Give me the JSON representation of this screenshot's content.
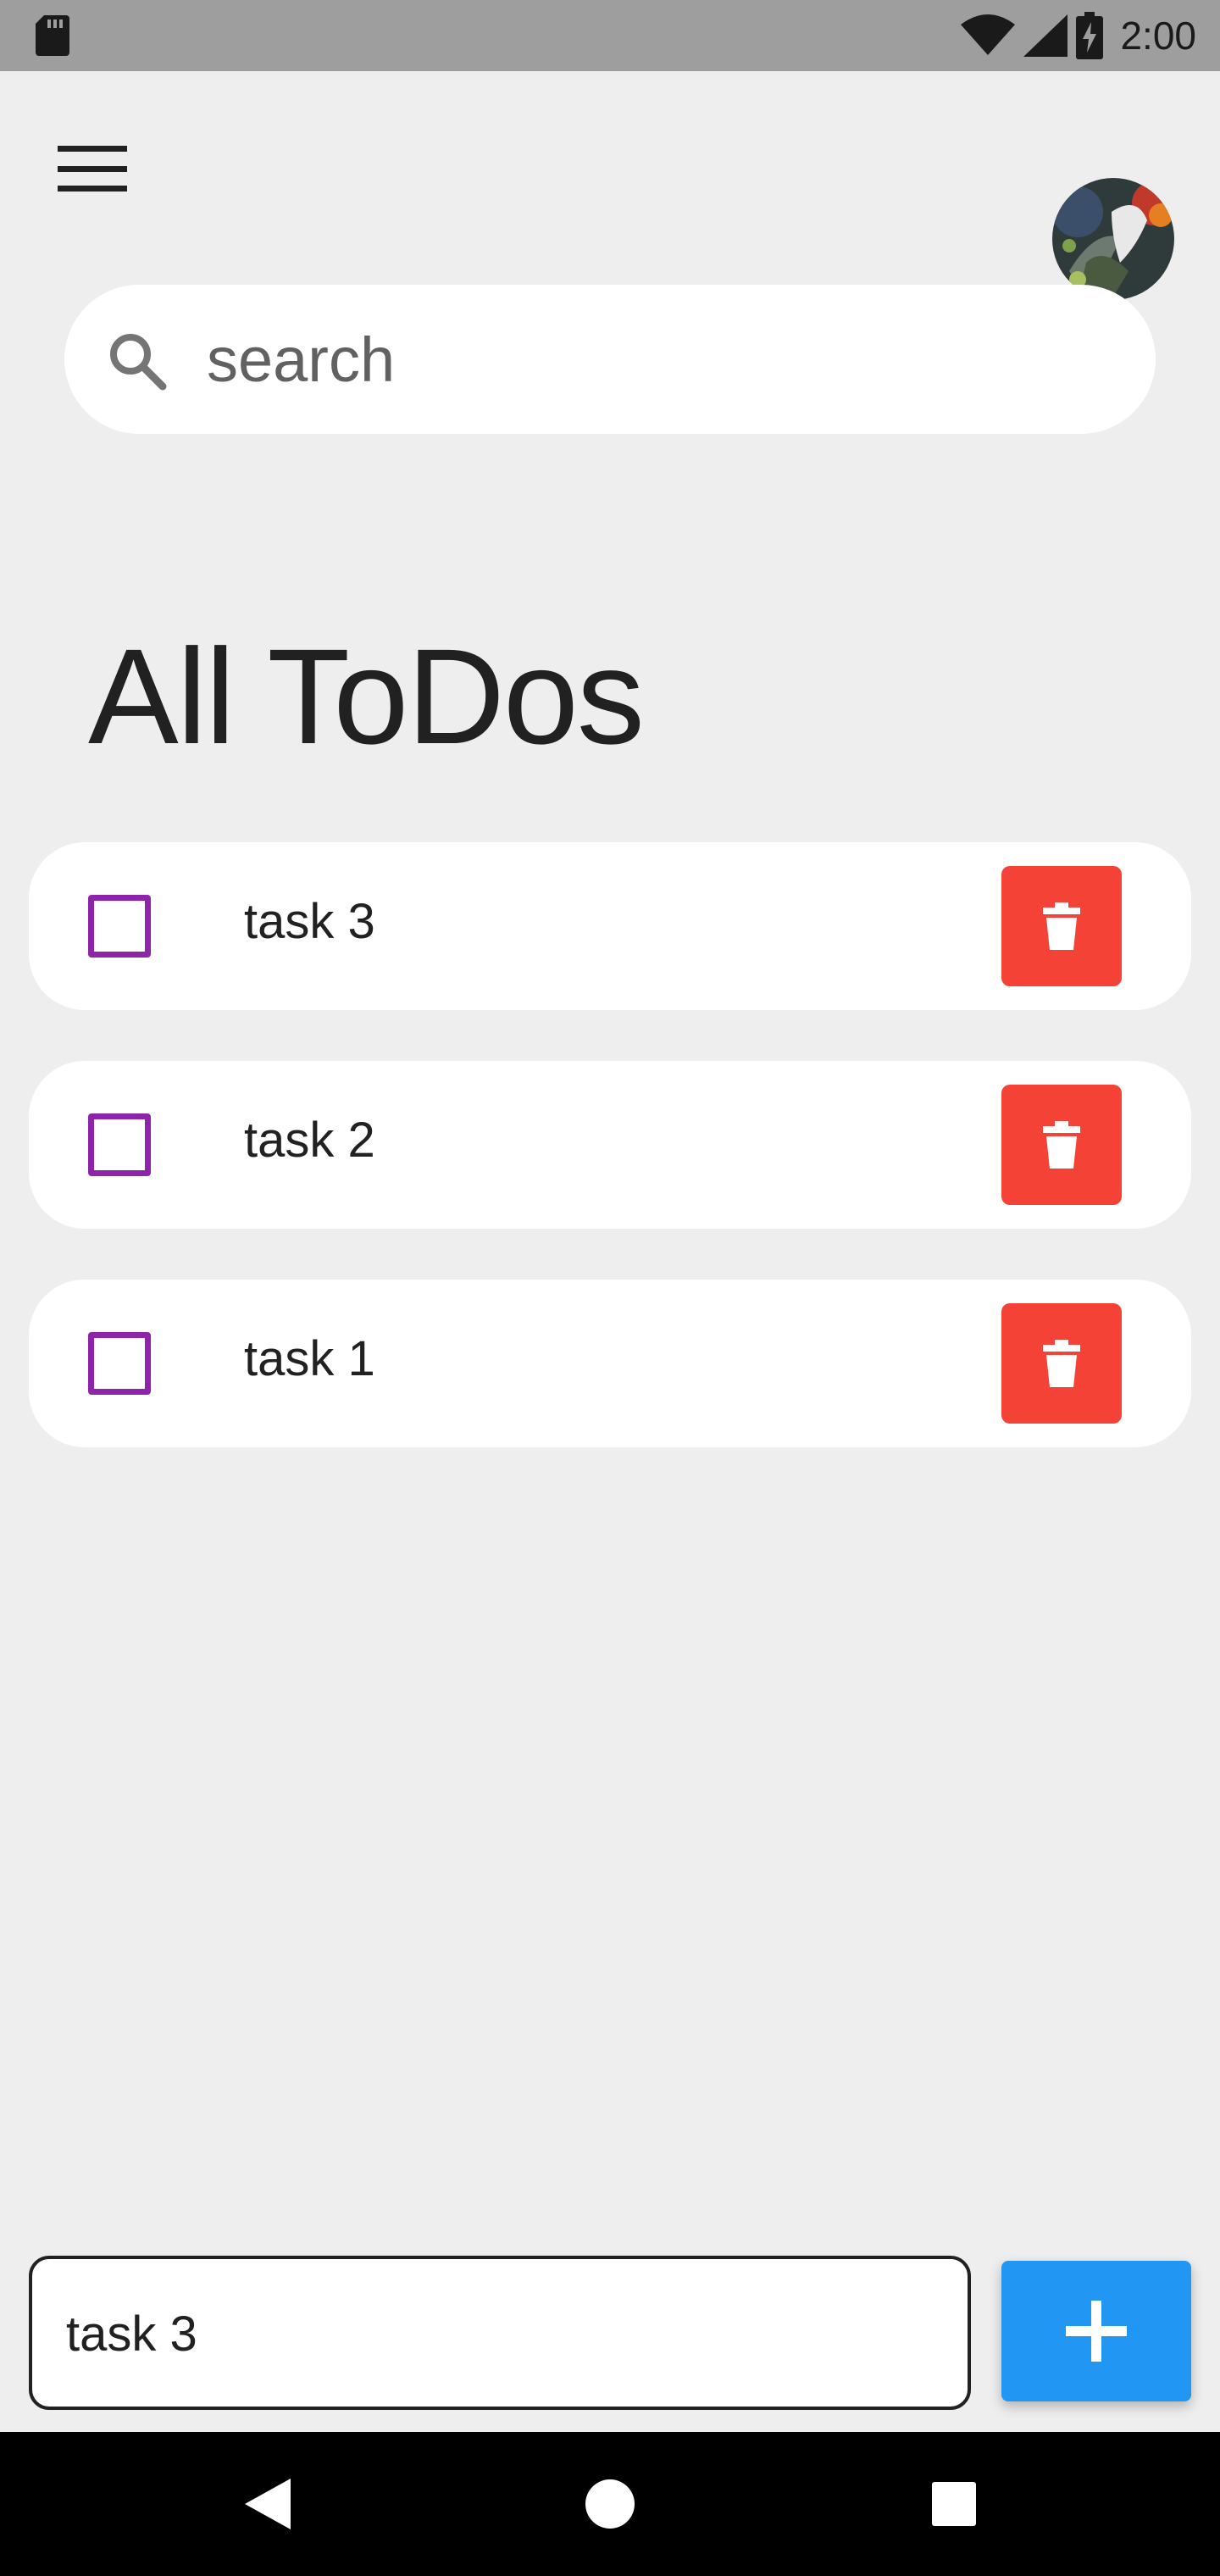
{
  "status_bar": {
    "time": "2:00",
    "icons": [
      "sd-card-icon",
      "wifi-icon",
      "signal-icon",
      "battery-charging-icon"
    ]
  },
  "header": {
    "menu_icon": "menu-icon",
    "avatar": "user-avatar"
  },
  "search": {
    "placeholder": "search",
    "value": "",
    "icon": "search-icon"
  },
  "main": {
    "title": "All ToDos",
    "todos": [
      {
        "label": "task 3",
        "checked": false
      },
      {
        "label": "task 2",
        "checked": false
      },
      {
        "label": "task 1",
        "checked": false
      }
    ]
  },
  "composer": {
    "input_value": "task 3",
    "add_icon": "plus-icon"
  },
  "nav_bar": {
    "icons": [
      "back-icon",
      "home-icon",
      "recents-icon"
    ]
  },
  "colors": {
    "background": "#eeeeee",
    "checkbox": "#8e24aa",
    "delete": "#f44336",
    "add": "#2196f3",
    "status_bar": "#9e9e9e"
  }
}
